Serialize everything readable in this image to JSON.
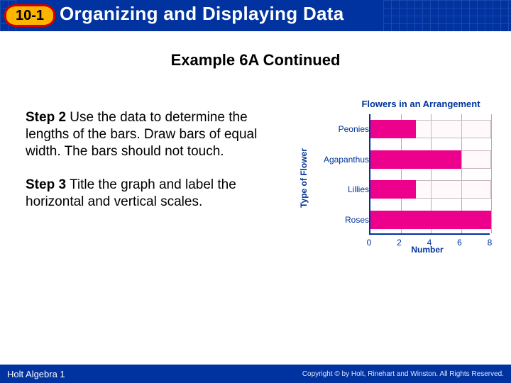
{
  "header": {
    "lesson_number": "10-1",
    "title": "Organizing and Displaying Data"
  },
  "example_title": "Example 6A Continued",
  "steps": [
    {
      "label": "Step 2",
      "text": " Use the data to determine the lengths of the bars. Draw bars of equal width. The bars should not touch."
    },
    {
      "label": "Step 3",
      "text": " Title the graph and label the horizontal and vertical scales."
    }
  ],
  "chart_data": {
    "type": "bar",
    "orientation": "horizontal",
    "title": "Flowers in an Arrangement",
    "ylabel": "Type of Flower",
    "xlabel": "Number",
    "categories": [
      "Peonies",
      "Agapanthus",
      "Lillies",
      "Roses"
    ],
    "values": [
      3,
      6,
      3,
      8
    ],
    "ticks": [
      0,
      2,
      4,
      6,
      8
    ],
    "xlim": [
      0,
      8
    ]
  },
  "footer": {
    "left": "Holt Algebra 1",
    "right": "Copyright © by Holt, Rinehart and Winston. All Rights Reserved."
  }
}
